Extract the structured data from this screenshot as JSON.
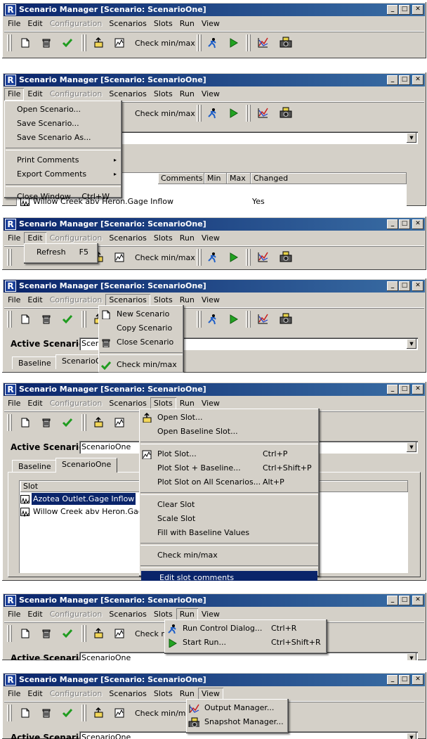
{
  "window": {
    "title": "Scenario Manager [Scenario: ScenarioOne]"
  },
  "menus": {
    "file": "File",
    "edit": "Edit",
    "configuration": "Configuration",
    "scenarios": "Scenarios",
    "slots": "Slots",
    "run": "Run",
    "view": "View"
  },
  "toolbar": {
    "check_minmax": "Check min/max"
  },
  "active_scenario": {
    "label": "Active Scenario:",
    "value": "ScenarioOne",
    "value_clipped": "Scen"
  },
  "tabs": {
    "baseline": "Baseline",
    "scenario_one": "ScenarioOne",
    "scenario_one_clipped": "ScenarioO"
  },
  "table": {
    "columns": {
      "slot": "Slot",
      "comments": "Comments",
      "min": "Min",
      "max": "Max",
      "changed": "Changed"
    },
    "rows": [
      {
        "slot": "Azotea Outlet.Gage Inflow",
        "changed": ""
      },
      {
        "slot": "Willow Creek abv Heron.Gage Inflow",
        "slot_clipped": "Willow Creek abv Heron.Gage I",
        "changed": "Yes"
      }
    ]
  },
  "file_menu": {
    "open": "Open Scenario...",
    "save": "Save Scenario...",
    "save_as": "Save Scenario As...",
    "print_comments": "Print Comments",
    "export_comments": "Export Comments",
    "close": "Close Window",
    "close_shortcut": "Ctrl+W",
    "submenu_arrow": "▸"
  },
  "edit_menu": {
    "refresh": "Refresh",
    "refresh_shortcut": "F5"
  },
  "scenarios_menu": {
    "new": "New Scenario",
    "copy": "Copy Scenario",
    "close": "Close Scenario",
    "check": "Check min/max"
  },
  "slots_menu": {
    "open_slot": "Open Slot...",
    "open_baseline": "Open Baseline Slot...",
    "plot_slot": "Plot Slot...",
    "plot_slot_sc": "Ctrl+P",
    "plot_baseline": "Plot Slot + Baseline...",
    "plot_baseline_sc": "Ctrl+Shift+P",
    "plot_all": "Plot Slot  on All Scenarios...",
    "plot_all_sc": "Alt+P",
    "clear": "Clear Slot",
    "scale": "Scale Slot",
    "fill": "Fill with Baseline Values",
    "check": "Check min/max",
    "edit_comments": "Edit slot comments"
  },
  "run_menu": {
    "control": "Run Control Dialog...",
    "control_sc": "Ctrl+R",
    "start": "Start Run...",
    "start_sc": "Ctrl+Shift+R"
  },
  "view_menu": {
    "output": "Output Manager...",
    "snapshot": "Snapshot Manager..."
  },
  "colors": {
    "title_start": "#0a246a",
    "title_end": "#3a6ea5",
    "face": "#d4d0c8",
    "highlight": "#0a246a",
    "check_green": "#1f9c1f"
  }
}
